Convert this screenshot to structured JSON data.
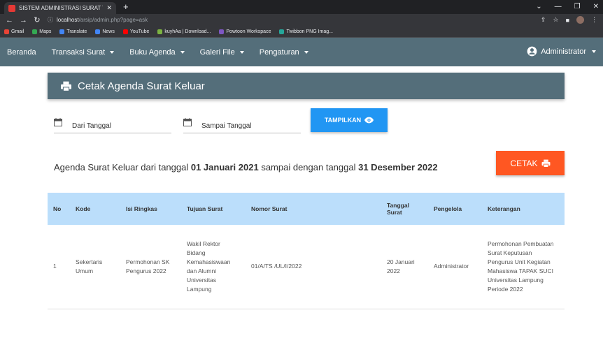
{
  "browser": {
    "tab_title": "SISTEM ADMINISTRASI SURAT TE",
    "url_host": "localhost",
    "url_path": "/arsip/admin.php?page=ask",
    "bookmarks": [
      {
        "label": "Gmail",
        "color": "#ea4335"
      },
      {
        "label": "Maps",
        "color": "#34a853"
      },
      {
        "label": "Translate",
        "color": "#4285f4"
      },
      {
        "label": "News",
        "color": "#4285f4"
      },
      {
        "label": "YouTube",
        "color": "#ff0000"
      },
      {
        "label": "kuyhAa | Download...",
        "color": "#7cb342"
      },
      {
        "label": "Powtoon Workspace",
        "color": "#7e57c2"
      },
      {
        "label": "Twibbon PNG Imag...",
        "color": "#26a69a"
      }
    ]
  },
  "nav": {
    "items": [
      "Beranda",
      "Transaksi Surat",
      "Buku Agenda",
      "Galeri File",
      "Pengaturan"
    ],
    "user": "Administrator"
  },
  "panel": {
    "title": "Cetak Agenda Surat Keluar"
  },
  "filter": {
    "from_label": "Dari Tanggal",
    "to_label": "Sampai Tanggal",
    "show_label": "TAMPILKAN"
  },
  "print_label": "CETAK",
  "summary": {
    "prefix": "Agenda Surat Keluar dari tanggal ",
    "from_date": "01 Januari 2021",
    "middle": " sampai dengan tanggal ",
    "to_date": "31 Desember 2022"
  },
  "table": {
    "headers": [
      "No",
      "Kode",
      "Isi Ringkas",
      "Tujuan Surat",
      "Nomor Surat",
      "Tanggal Surat",
      "Pengelola",
      "Keterangan"
    ],
    "rows": [
      [
        "1",
        "Sekertaris Umum",
        "Permohonan SK Pengurus 2022",
        "Wakil Rektor Bidang Kemahasiswaan dan Alumni Universitas Lampung",
        "01/A/TS /UL/I/2022",
        "20 Januari 2022",
        "Administrator",
        "Permohonan Pembuatan Surat Keputusan Pengurus Unit Kegiatan Mahasiswa TAPAK SUCI Universitas Lampung Periode 2022"
      ]
    ]
  },
  "colors": {
    "navbar": "#546e7a",
    "show_button": "#2196f3",
    "print_button": "#ff5722",
    "table_header": "#bbdefb"
  }
}
